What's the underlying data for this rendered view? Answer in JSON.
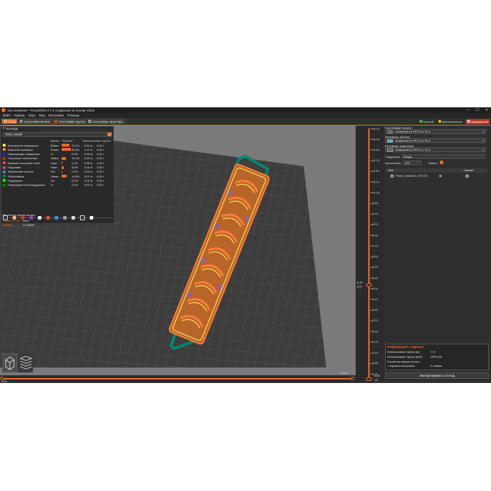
{
  "window": {
    "title": "Без названия - PrusaSlicer-2.7.4 созданная на основе Slic3r"
  },
  "menu": [
    "Файл",
    "Правка",
    "Окно",
    "Вид",
    "Настройки",
    "Помощь"
  ],
  "tabs": [
    {
      "label": "Стол",
      "active": true
    },
    {
      "label": "Настройки печати",
      "active": false
    },
    {
      "label": "Настройки прутка",
      "active": false
    },
    {
      "label": "Настройки принтера",
      "active": false
    }
  ],
  "modes": [
    {
      "label": "Простой",
      "color": "#2ecc40"
    },
    {
      "label": "Дополнительно",
      "color": "#f1c40f"
    },
    {
      "label": "Продвинутый",
      "color": "#e74c3c"
    }
  ],
  "legend": {
    "title": "Легенда",
    "view_type": "Типы линий",
    "columns": {
      "time": "Время",
      "percent": "Процент",
      "used": "Использовано прутка"
    },
    "rows": [
      {
        "name": "Внутренние периметры",
        "time": "32мин",
        "pct_label": "25,1%",
        "pct": 25.1,
        "m": "9,59 м",
        "g": "0,00 г",
        "color": "#ffe64d"
      },
      {
        "name": "Внешний периметр",
        "time": "37мин",
        "pct_label": "28,9%",
        "pct": 28.9,
        "m": "1,07 м",
        "g": "0,00 г",
        "color": "#ff7d38"
      },
      {
        "name": "Нависающие периметры",
        "time": "7с",
        "pct_label": "0,0%",
        "pct": 0.0,
        "m": "0,00 м",
        "g": "0,00 г",
        "color": "#1f1fff"
      },
      {
        "name": "Сплошное заполнение",
        "time": "18мин",
        "pct_label": "14,0%",
        "pct": 14.0,
        "m": "0,52 м",
        "g": "0,00 г",
        "color": "#b03029"
      },
      {
        "name": "Верхний сплошной слой",
        "time": "1мин",
        "pct_label": "1,2%",
        "pct": 1.2,
        "m": "0,05 м",
        "g": "0,00 г",
        "color": "#f04040"
      },
      {
        "name": "Подложка",
        "time": "7мин",
        "pct_label": "6,0%",
        "pct": 6.0,
        "m": "0,31 м",
        "g": "0,00 г",
        "color": "#a8507a"
      },
      {
        "name": "Заполнение мостов",
        "time": "15с",
        "pct_label": "0,2%",
        "pct": 0.2,
        "m": "0,02 м",
        "g": "0,00 г",
        "color": "#4d80ba"
      },
      {
        "name": "Юбка/Кайма",
        "time": "19мин",
        "pct_label": "14,8%",
        "pct": 14.8,
        "m": "1,07 м",
        "g": "0,00 г",
        "color": "#00876e"
      },
      {
        "name": "Поддержка",
        "time": "11с",
        "pct_label": "0,1%",
        "pct": 0.1,
        "m": "0,01 м",
        "g": "0,00 г",
        "color": "#00ff00"
      },
      {
        "name": "Связующий слой поддержки",
        "time": "7с",
        "pct_label": "0,1%",
        "pct": 0.1,
        "m": "0,00 м",
        "g": "0,00 г",
        "color": "#008000"
      }
    ],
    "estimated_label": "Расчётное время печати:",
    "first_layer_label": "Первый слой:",
    "first_layer_value": "3мин",
    "total_label": "Общее:",
    "total_value": "1ч 48мин"
  },
  "hslider": {
    "left_value": "5861",
    "right_value": "6040"
  },
  "vslider": {
    "ticks": [
      "14,00",
      "13,40",
      "12,80",
      "12,20",
      "11,60",
      "11,00",
      "10,40",
      "9,80",
      "9,20",
      "8,60",
      "8,00",
      "7,40",
      "6,80",
      "6,20",
      "5,60",
      "5,00",
      "4,40",
      "3,80",
      "3,20",
      "2,60",
      "2,00",
      "1,40",
      "0,80",
      "0,20"
    ],
    "current_top": "5,40",
    "current_bottom": "(27)",
    "bottom_value": "0,20",
    "bottom_index": "(1)"
  },
  "right_panel": {
    "print_settings_label": "Настройки печати:",
    "print_settings_value": "Dndseimd for PETG or PLA",
    "filament_label": "Профиль прутка:",
    "filament_value": "Dndseimd for PETG or PLA",
    "filament_color": "#1fb5c9",
    "printer_label": "Профиль принтера:",
    "printer_value": "Dndseimd for PETG or PLA",
    "supports_label": "Поддержки:",
    "supports_value": "Везде",
    "infill_label": "Заполнение:",
    "infill_value": "0%",
    "brim_label": "Кайма:",
    "objects_columns": {
      "name": "Имя",
      "edit": "Правка"
    },
    "object_name": "Probe_Holder10_007.STL",
    "info_title": "Информация о нарезке",
    "info_rows": [
      {
        "label": "Использовано прутка (м)",
        "value": "7,72"
      },
      {
        "label": "Использовано прутка (мм³)",
        "value": "18574,58"
      },
      {
        "label": "Расчётное время печати:",
        "value": ""
      },
      {
        "label": "- нормальный режим",
        "value": "1ч 48мин"
      }
    ],
    "export_label": "Экспортировать в G-код"
  },
  "colors": {
    "accent": "#ed6b21",
    "bed": "#3d3d3d",
    "background": "#7a7a7a",
    "skirt": "#00876e",
    "outer_perimeter": "#ff7d38",
    "inner_perimeter": "#ffe64d",
    "overhang": "#8a5cc4"
  }
}
